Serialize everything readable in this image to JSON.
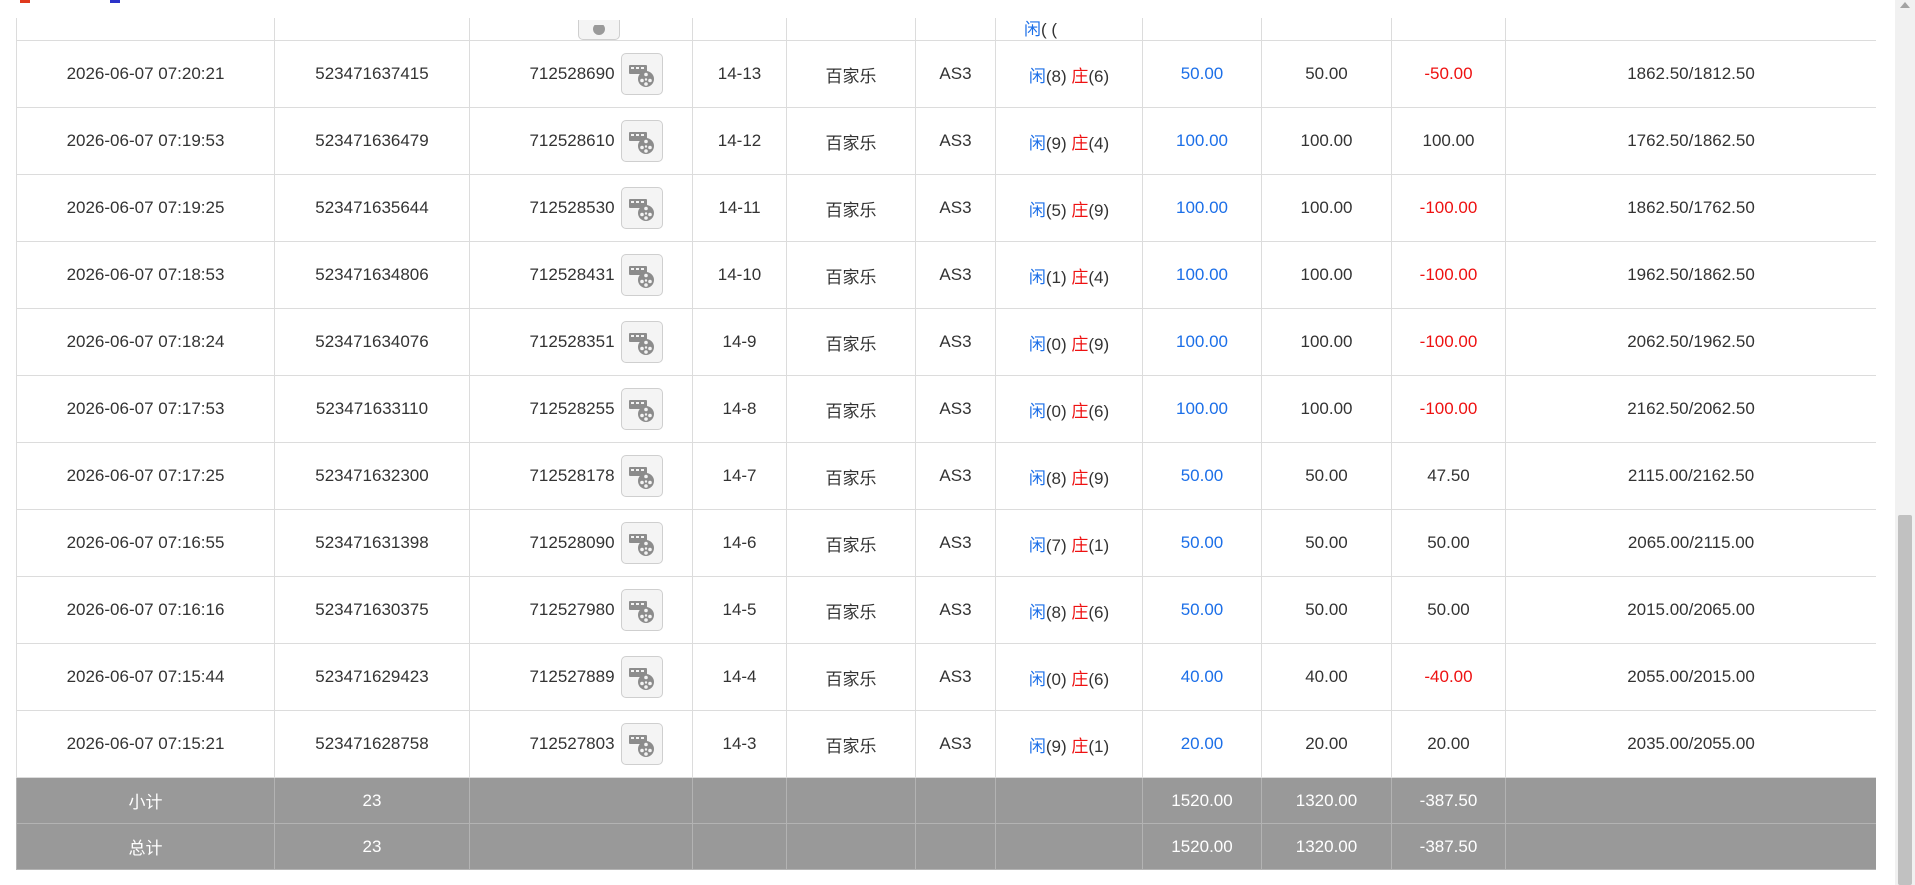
{
  "partial_row": {
    "time": "",
    "bet_id": "",
    "round_id": "",
    "shoe": "",
    "game": "",
    "table": "",
    "player_label": "闲",
    "player_value": "(",
    "banker_label": "",
    "banker_value": "(",
    "bet": "",
    "valid": "",
    "win": "",
    "balance": ""
  },
  "rows": [
    {
      "time": "2026-06-07 07:20:21",
      "bet_id": "523471637415",
      "round_id": "712528690",
      "shoe": "14-13",
      "game": "百家乐",
      "table": "AS3",
      "player_label": "闲",
      "player_value": "(8)",
      "banker_label": "庄",
      "banker_value": "(6)",
      "bet": "50.00",
      "valid": "50.00",
      "win": "-50.00",
      "balance": "1862.50/1812.50"
    },
    {
      "time": "2026-06-07 07:19:53",
      "bet_id": "523471636479",
      "round_id": "712528610",
      "shoe": "14-12",
      "game": "百家乐",
      "table": "AS3",
      "player_label": "闲",
      "player_value": "(9)",
      "banker_label": "庄",
      "banker_value": "(4)",
      "bet": "100.00",
      "valid": "100.00",
      "win": "100.00",
      "balance": "1762.50/1862.50"
    },
    {
      "time": "2026-06-07 07:19:25",
      "bet_id": "523471635644",
      "round_id": "712528530",
      "shoe": "14-11",
      "game": "百家乐",
      "table": "AS3",
      "player_label": "闲",
      "player_value": "(5)",
      "banker_label": "庄",
      "banker_value": "(9)",
      "bet": "100.00",
      "valid": "100.00",
      "win": "-100.00",
      "balance": "1862.50/1762.50"
    },
    {
      "time": "2026-06-07 07:18:53",
      "bet_id": "523471634806",
      "round_id": "712528431",
      "shoe": "14-10",
      "game": "百家乐",
      "table": "AS3",
      "player_label": "闲",
      "player_value": "(1)",
      "banker_label": "庄",
      "banker_value": "(4)",
      "bet": "100.00",
      "valid": "100.00",
      "win": "-100.00",
      "balance": "1962.50/1862.50"
    },
    {
      "time": "2026-06-07 07:18:24",
      "bet_id": "523471634076",
      "round_id": "712528351",
      "shoe": "14-9",
      "game": "百家乐",
      "table": "AS3",
      "player_label": "闲",
      "player_value": "(0)",
      "banker_label": "庄",
      "banker_value": "(9)",
      "bet": "100.00",
      "valid": "100.00",
      "win": "-100.00",
      "balance": "2062.50/1962.50"
    },
    {
      "time": "2026-06-07 07:17:53",
      "bet_id": "523471633110",
      "round_id": "712528255",
      "shoe": "14-8",
      "game": "百家乐",
      "table": "AS3",
      "player_label": "闲",
      "player_value": "(0)",
      "banker_label": "庄",
      "banker_value": "(6)",
      "bet": "100.00",
      "valid": "100.00",
      "win": "-100.00",
      "balance": "2162.50/2062.50"
    },
    {
      "time": "2026-06-07 07:17:25",
      "bet_id": "523471632300",
      "round_id": "712528178",
      "shoe": "14-7",
      "game": "百家乐",
      "table": "AS3",
      "player_label": "闲",
      "player_value": "(8)",
      "banker_label": "庄",
      "banker_value": "(9)",
      "bet": "50.00",
      "valid": "50.00",
      "win": "47.50",
      "balance": "2115.00/2162.50"
    },
    {
      "time": "2026-06-07 07:16:55",
      "bet_id": "523471631398",
      "round_id": "712528090",
      "shoe": "14-6",
      "game": "百家乐",
      "table": "AS3",
      "player_label": "闲",
      "player_value": "(7)",
      "banker_label": "庄",
      "banker_value": "(1)",
      "bet": "50.00",
      "valid": "50.00",
      "win": "50.00",
      "balance": "2065.00/2115.00"
    },
    {
      "time": "2026-06-07 07:16:16",
      "bet_id": "523471630375",
      "round_id": "712527980",
      "shoe": "14-5",
      "game": "百家乐",
      "table": "AS3",
      "player_label": "闲",
      "player_value": "(8)",
      "banker_label": "庄",
      "banker_value": "(6)",
      "bet": "50.00",
      "valid": "50.00",
      "win": "50.00",
      "balance": "2015.00/2065.00"
    },
    {
      "time": "2026-06-07 07:15:44",
      "bet_id": "523471629423",
      "round_id": "712527889",
      "shoe": "14-4",
      "game": "百家乐",
      "table": "AS3",
      "player_label": "闲",
      "player_value": "(0)",
      "banker_label": "庄",
      "banker_value": "(6)",
      "bet": "40.00",
      "valid": "40.00",
      "win": "-40.00",
      "balance": "2055.00/2015.00"
    },
    {
      "time": "2026-06-07 07:15:21",
      "bet_id": "523471628758",
      "round_id": "712527803",
      "shoe": "14-3",
      "game": "百家乐",
      "table": "AS3",
      "player_label": "闲",
      "player_value": "(9)",
      "banker_label": "庄",
      "banker_value": "(1)",
      "bet": "20.00",
      "valid": "20.00",
      "win": "20.00",
      "balance": "2035.00/2055.00"
    }
  ],
  "subtotal": {
    "label": "小计",
    "count": "23",
    "bet": "1520.00",
    "valid": "1320.00",
    "win": "-387.50"
  },
  "total": {
    "label": "总计",
    "count": "23",
    "bet": "1520.00",
    "valid": "1320.00",
    "win": "-387.50"
  },
  "icons": {
    "replay": "film-reel-icon"
  },
  "colors": {
    "player": "#1c6fe8",
    "banker": "#ee1111",
    "loss": "#ee1111",
    "footer_bg": "#999999"
  }
}
